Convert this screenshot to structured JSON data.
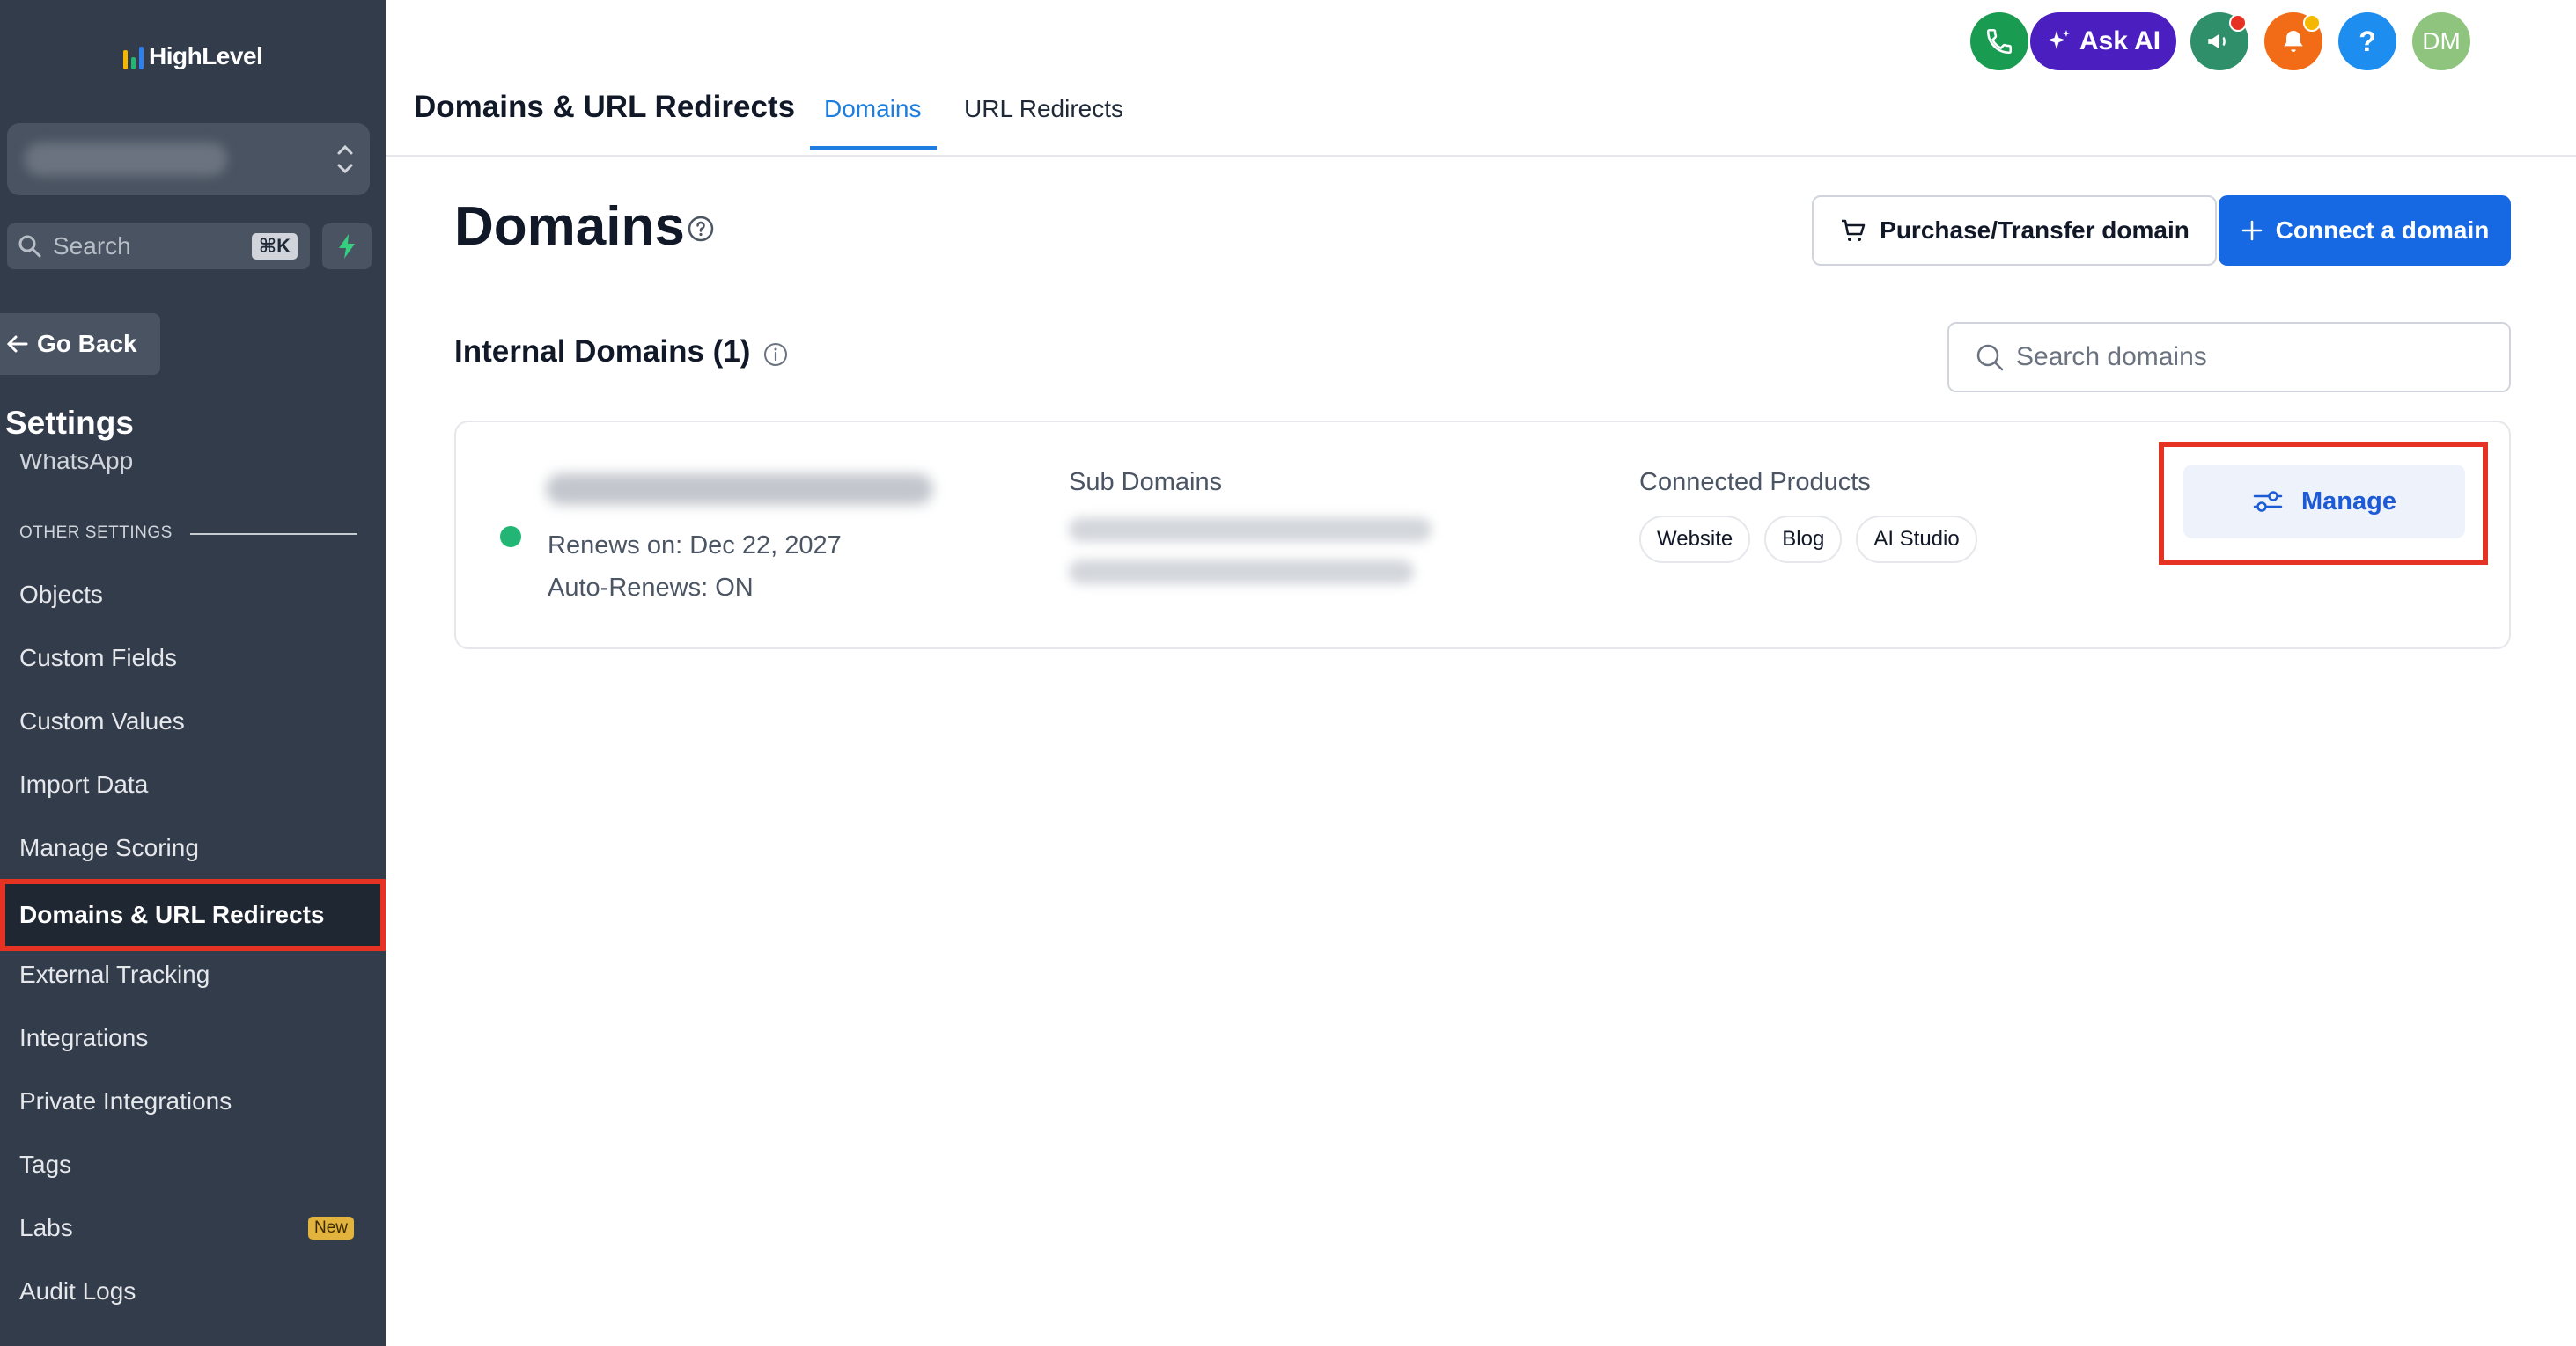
{
  "brand": {
    "name": "HighLevel",
    "logo_colors": [
      "#f5b700",
      "#22b573",
      "#2f80ed"
    ]
  },
  "sidebar": {
    "search_placeholder": "Search",
    "search_shortcut": "⌘K",
    "go_back_label": "Go Back",
    "settings_title": "Settings",
    "partial_item": "WhatsApp",
    "section_label": "OTHER SETTINGS",
    "items": [
      {
        "label": "Objects"
      },
      {
        "label": "Custom Fields"
      },
      {
        "label": "Custom Values"
      },
      {
        "label": "Import Data"
      },
      {
        "label": "Manage Scoring"
      },
      {
        "label": "Domains & URL Redirects",
        "active": true
      },
      {
        "label": "External Tracking"
      },
      {
        "label": "Integrations"
      },
      {
        "label": "Private Integrations"
      },
      {
        "label": "Tags"
      },
      {
        "label": "Labs",
        "badge": "New"
      },
      {
        "label": "Audit Logs"
      }
    ]
  },
  "header": {
    "title": "Domains & URL Redirects",
    "tabs": [
      {
        "label": "Domains",
        "active": true
      },
      {
        "label": "URL Redirects"
      }
    ],
    "ask_ai_label": "Ask AI",
    "avatar_initials": "DM",
    "icon_colors": {
      "phone": "#1a9b52",
      "ask_ai": "#4b1fbf",
      "announce": "#2f8f6b",
      "bell": "#f26b16",
      "help": "#1d8ef0",
      "avatar": "#8fc47e"
    }
  },
  "main": {
    "title": "Domains",
    "purchase_label": "Purchase/Transfer domain",
    "connect_label": "Connect a domain",
    "section_title": "Internal Domains (1)",
    "search_placeholder": "Search domains",
    "domain_card": {
      "renews": "Renews on: Dec 22, 2027",
      "auto_renews": "Auto-Renews: ON",
      "sub_domains_heading": "Sub Domains",
      "connected_products_heading": "Connected Products",
      "products": [
        "Website",
        "Blog",
        "AI Studio"
      ],
      "manage_label": "Manage",
      "status_color": "#22b573"
    }
  }
}
